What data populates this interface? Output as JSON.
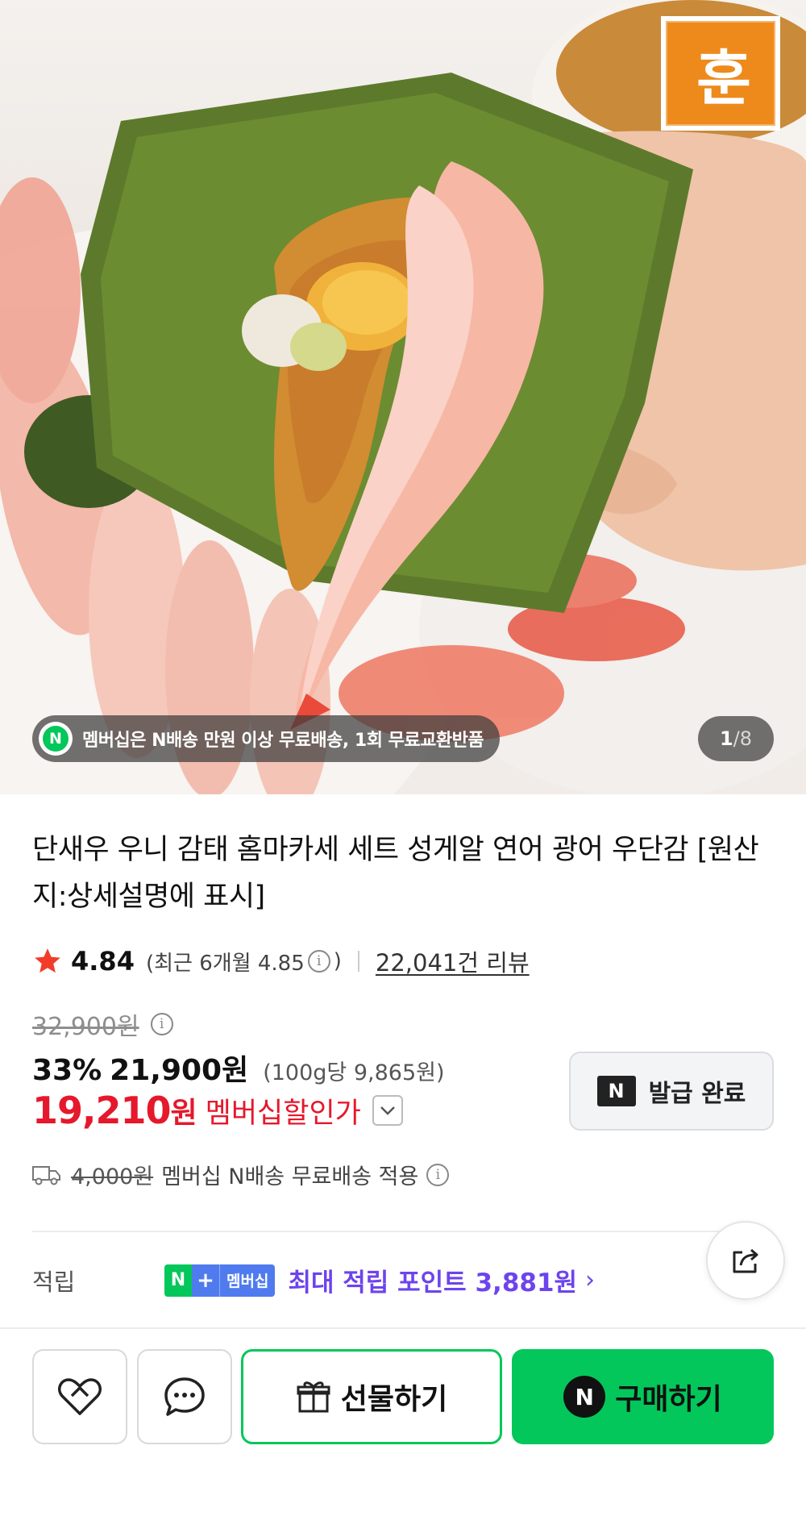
{
  "hero": {
    "brand_logo_text": "훈",
    "promo_badge": "N",
    "promo_text": "멤버십은 N배송 만원 이상 무료배송, 1회 무료교환반품",
    "image_index": "1",
    "image_sep": "/",
    "image_total": "8"
  },
  "product": {
    "title": "단새우 우니 감태 홈마카세 세트 성게알 연어 광어 우단감 [원산지:상세설명에 표시]",
    "rating": "4.84",
    "recent_rating_prefix": "(최근 6개월 4.85",
    "recent_rating_suffix": ")",
    "review_count": "22,041건 리뷰",
    "original_price": "32,900원",
    "discount_rate": "33%",
    "sale_price": "21,900원",
    "unit_price": "(100g당 9,865원)",
    "member_price": "19,210",
    "member_price_unit": "원",
    "member_price_label": "멤버십할인가",
    "info_glyph": "i"
  },
  "coupon": {
    "badge": "N",
    "label": "발급 완료"
  },
  "shipping": {
    "original_fee": "4,000원",
    "text": "멤버십 N배송 무료배송 적용"
  },
  "points": {
    "label": "적립",
    "badge_n": "N",
    "badge_plus": "+",
    "badge_member": "멤버십",
    "text": "최대 적립 포인트 3,881원",
    "chevron": "›"
  },
  "actions": {
    "gift_label": "선물하기",
    "buy_badge": "N",
    "buy_label": "구매하기"
  },
  "colors": {
    "naver_green": "#03c75a",
    "member_red": "#e5182c",
    "points_purple": "#6d44ec",
    "brand_orange": "#ee8a1c"
  },
  "icons": [
    "brand-logo",
    "star-icon",
    "info-icon",
    "chevron-down-icon",
    "truck-icon",
    "share-icon",
    "heart-icon",
    "chat-icon",
    "gift-icon"
  ]
}
